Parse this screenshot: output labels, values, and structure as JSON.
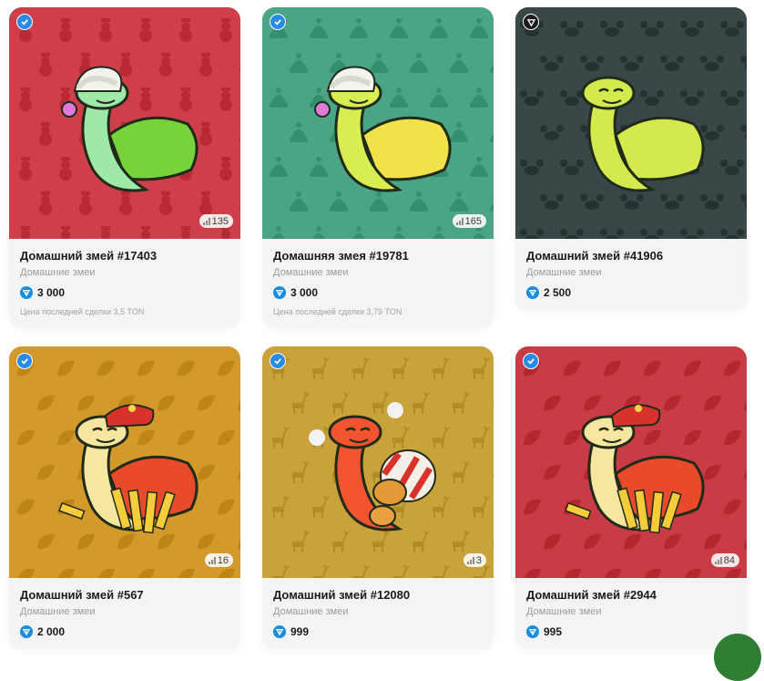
{
  "cards": [
    {
      "name": "Домашний змей #17403",
      "collection": "Домашние змеи",
      "price": "3 000",
      "owners": "135",
      "last_sale": "Цена последней сделки 3,5 TON",
      "bg": "#cf3f49",
      "pattern": "snowman",
      "badge_icon": "check-badge-icon",
      "snake_body": "#9ee8a8",
      "snake_sleeve": "#78d23a",
      "hat": "santa-hat"
    },
    {
      "name": "Домашняя змея #19781",
      "collection": "Домашние змеи",
      "price": "3 000",
      "owners": "165",
      "last_sale": "Цена последней сделки 3,79 TON",
      "bg": "#4aa585",
      "pattern": "beanie",
      "badge_icon": "check-badge-icon",
      "snake_body": "#d8ee50",
      "snake_sleeve": "#f2e24a",
      "hat": "santa-hat"
    },
    {
      "name": "Домашний змей #41906",
      "collection": "Домашние змеи",
      "price": "2 500",
      "owners": "",
      "last_sale": "",
      "bg": "#3b4749",
      "pattern": "crab",
      "badge_icon": "triangle-badge-icon",
      "snake_body": "#d4ea4c",
      "snake_sleeve": "#d4ea4c",
      "hat": "none"
    },
    {
      "name": "Домашний змей #567",
      "collection": "Домашние змеи",
      "price": "2 000",
      "owners": "16",
      "last_sale": "",
      "bg": "#d39a2c",
      "pattern": "leaf",
      "badge_icon": "check-badge-icon",
      "snake_body": "#f6e6a0",
      "snake_sleeve": "#e84a2a",
      "hat": "red-cap"
    },
    {
      "name": "Домашний змей #12080",
      "collection": "Домашние змеи",
      "price": "999",
      "owners": "3",
      "last_sale": "",
      "bg": "#c9a23a",
      "pattern": "deer",
      "badge_icon": "check-badge-icon",
      "snake_body": "#f25430",
      "snake_sleeve": "#f0a030",
      "hat": "chicken-bucket"
    },
    {
      "name": "Домашний змей #2944",
      "collection": "Домашние змеи",
      "price": "995",
      "owners": "84",
      "last_sale": "",
      "bg": "#c93d45",
      "pattern": "leaf",
      "badge_icon": "check-badge-icon",
      "snake_body": "#f6e6a0",
      "snake_sleeve": "#e84a2a",
      "hat": "red-cap"
    }
  ],
  "fab_color": "#2e7d32"
}
